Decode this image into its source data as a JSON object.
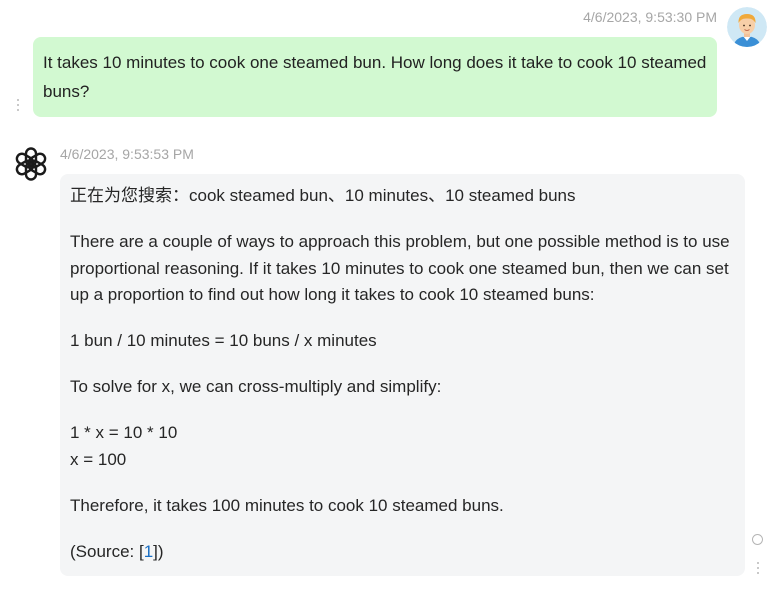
{
  "user_message": {
    "timestamp": "4/6/2023, 9:53:30 PM",
    "text": "It takes 10 minutes to cook one steamed bun. How long does it take to cook 10 steamed buns?"
  },
  "assistant_message": {
    "timestamp": "4/6/2023, 9:53:53 PM",
    "searching": "正在为您搜索：cook steamed bun、10 minutes、10 steamed buns",
    "paragraph_1": "There are a couple of ways to approach this problem, but one possible method is to use proportional reasoning. If it takes 10 minutes to cook one steamed bun, then we can set up a proportion to find out how long it takes to cook 10 steamed buns:",
    "equation": "1 bun / 10 minutes = 10 buns / x minutes",
    "paragraph_2": "To solve for x, we can cross-multiply and simplify:",
    "step_1": "1 * x = 10 * 10",
    "step_2": "x = 100",
    "conclusion": "Therefore, it takes 100 minutes to cook 10 steamed buns.",
    "source_prefix": "(Source: [",
    "source_link": "1",
    "source_suffix": "])"
  },
  "icons": {
    "user_avatar": "user-avatar-icon",
    "assistant_avatar": "openai-logo-icon",
    "more_menu": "more-vertical-icon",
    "status": "loading-circle-icon"
  },
  "colors": {
    "user_bubble": "#d2f9d1",
    "assistant_bubble": "#f4f5f6",
    "timestamp": "#a6a6a6",
    "link": "#1a6fc4"
  }
}
